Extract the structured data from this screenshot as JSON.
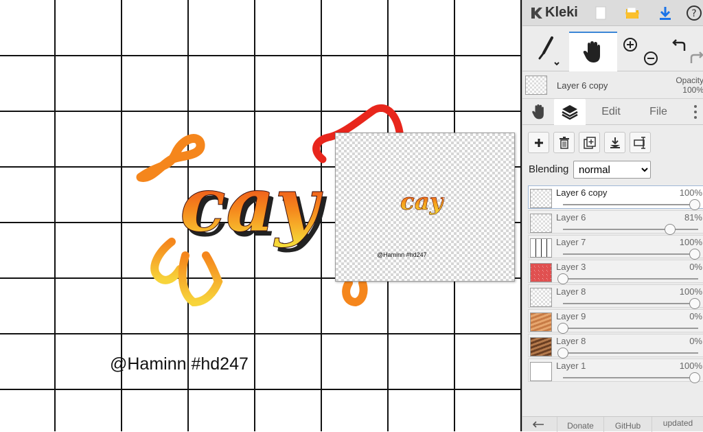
{
  "app": {
    "name": "Kleki"
  },
  "canvas": {
    "artwork_word": "cay",
    "signature": "@Haminn #hd247",
    "preview_word": "cay",
    "preview_signature": "@Haminn #hd247"
  },
  "colors": {
    "accent": "#3a86d6",
    "download": "#1a73e8",
    "folder": "#f4b400",
    "art_red": "#e8261c",
    "art_orange": "#f5861c",
    "art_yellow": "#f7e33b"
  },
  "toolbar": {
    "icons": [
      "kleki-logo-icon",
      "new-file-icon",
      "open-folder-icon",
      "download-icon",
      "help-icon"
    ],
    "tools": [
      "brush-icon",
      "hand-icon",
      "zoom-in-icon",
      "zoom-out-icon",
      "undo-icon",
      "redo-icon"
    ]
  },
  "current_layer": {
    "name": "Layer 6 copy",
    "opacity_label": "Opacity",
    "opacity_value": "100%"
  },
  "tabs": {
    "edit": "Edit",
    "file": "File"
  },
  "layer_actions": [
    "add-layer-icon",
    "delete-layer-icon",
    "duplicate-layer-icon",
    "merge-down-icon",
    "rename-layer-icon"
  ],
  "blending": {
    "label": "Blending",
    "value": "normal"
  },
  "layers": [
    {
      "name": "Layer 6 copy",
      "opacity": "100%",
      "level": 1.0,
      "active": true
    },
    {
      "name": "Layer 6",
      "opacity": "81%",
      "level": 0.81,
      "active": false
    },
    {
      "name": "Layer 7",
      "opacity": "100%",
      "level": 1.0,
      "active": false
    },
    {
      "name": "Layer 3",
      "opacity": "0%",
      "level": 0.0,
      "active": false
    },
    {
      "name": "Layer 8",
      "opacity": "100%",
      "level": 1.0,
      "active": false
    },
    {
      "name": "Layer 9",
      "opacity": "0%",
      "level": 0.0,
      "active": false
    },
    {
      "name": "Layer 8",
      "opacity": "0%",
      "level": 0.0,
      "active": false
    },
    {
      "name": "Layer 1",
      "opacity": "100%",
      "level": 1.0,
      "active": false
    }
  ],
  "footer": {
    "donate": "Donate",
    "github": "GitHub",
    "updated": "updated"
  }
}
